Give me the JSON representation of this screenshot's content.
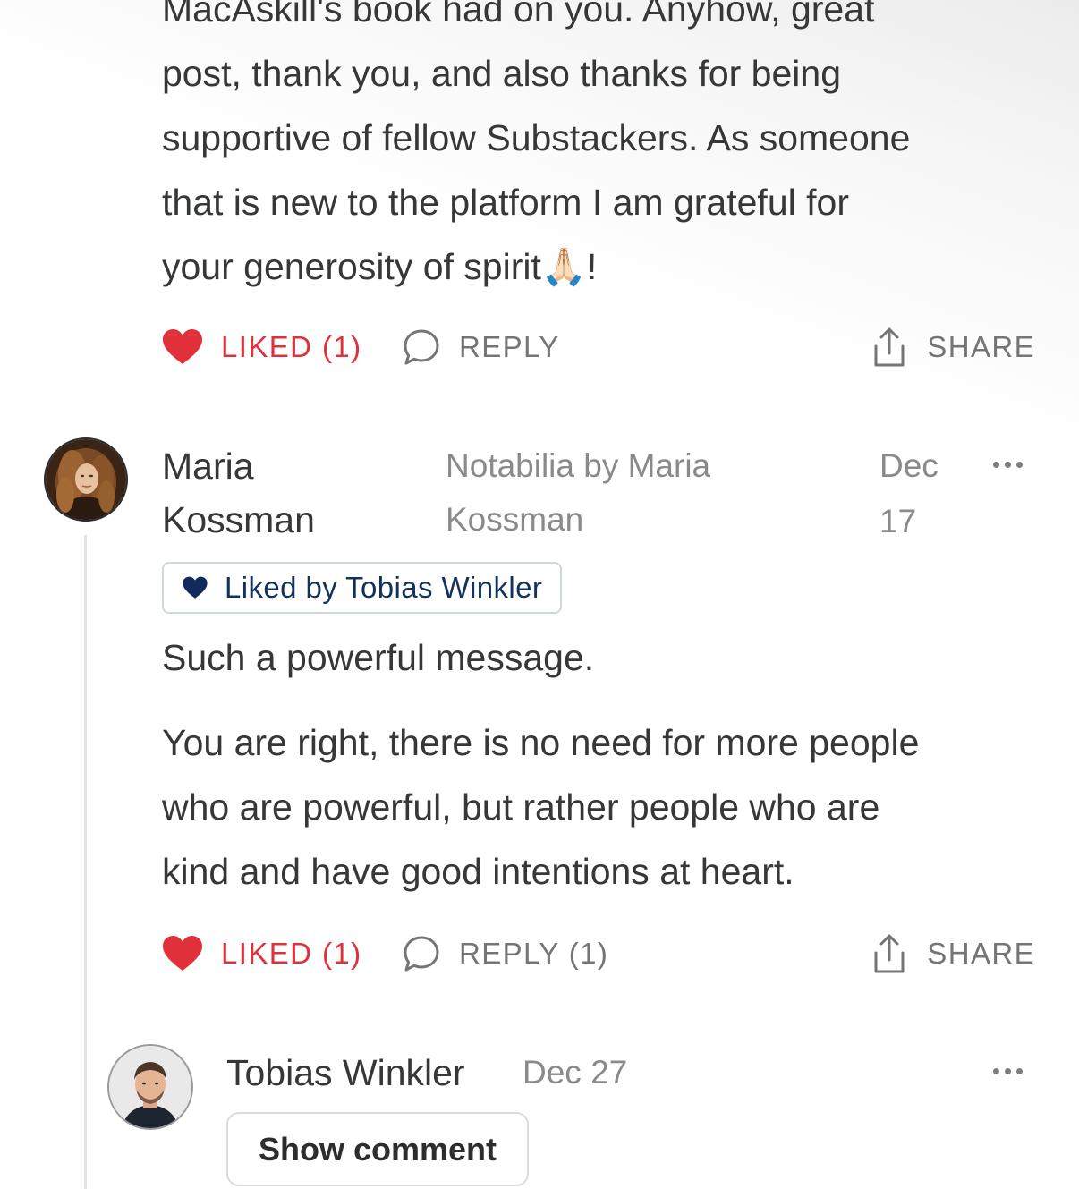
{
  "top_comment": {
    "body_lines": [
      "MacAskill's book had on you. Anyhow, great",
      "post, thank you, and also thanks for being",
      "supportive of fellow Substackers. As someone",
      "that is new to the platform I am grateful for",
      "your generosity of spirit🙏🏻!"
    ],
    "actions": {
      "like_label": "LIKED (1)",
      "reply_label": "REPLY",
      "share_label": "SHARE"
    }
  },
  "comment": {
    "author_first": "Maria",
    "author_last": "Kossman",
    "publication_line1": "Notabilia by Maria",
    "publication_line2": "Kossman",
    "date_line1": "Dec",
    "date_line2": "17",
    "avatar_icon": "avatar-photo-maria",
    "liked_by_label": "Liked by Tobias Winkler",
    "paragraph1": "Such a powerful message.",
    "paragraph2_lines": [
      "You are right, there is no need for more people",
      "who are powerful, but rather people who are",
      "kind and have good intentions at heart."
    ],
    "actions": {
      "like_label": "LIKED (1)",
      "reply_label": "REPLY (1)",
      "share_label": "SHARE"
    }
  },
  "reply": {
    "author": "Tobias Winkler",
    "date": "Dec 27",
    "avatar_icon": "avatar-photo-tobias",
    "show_comment_label": "Show comment"
  },
  "colors": {
    "liked_red": "#e0303a",
    "liked_by_heart": "#0f2a5c",
    "muted_text": "#757575",
    "body_text": "#363737"
  }
}
